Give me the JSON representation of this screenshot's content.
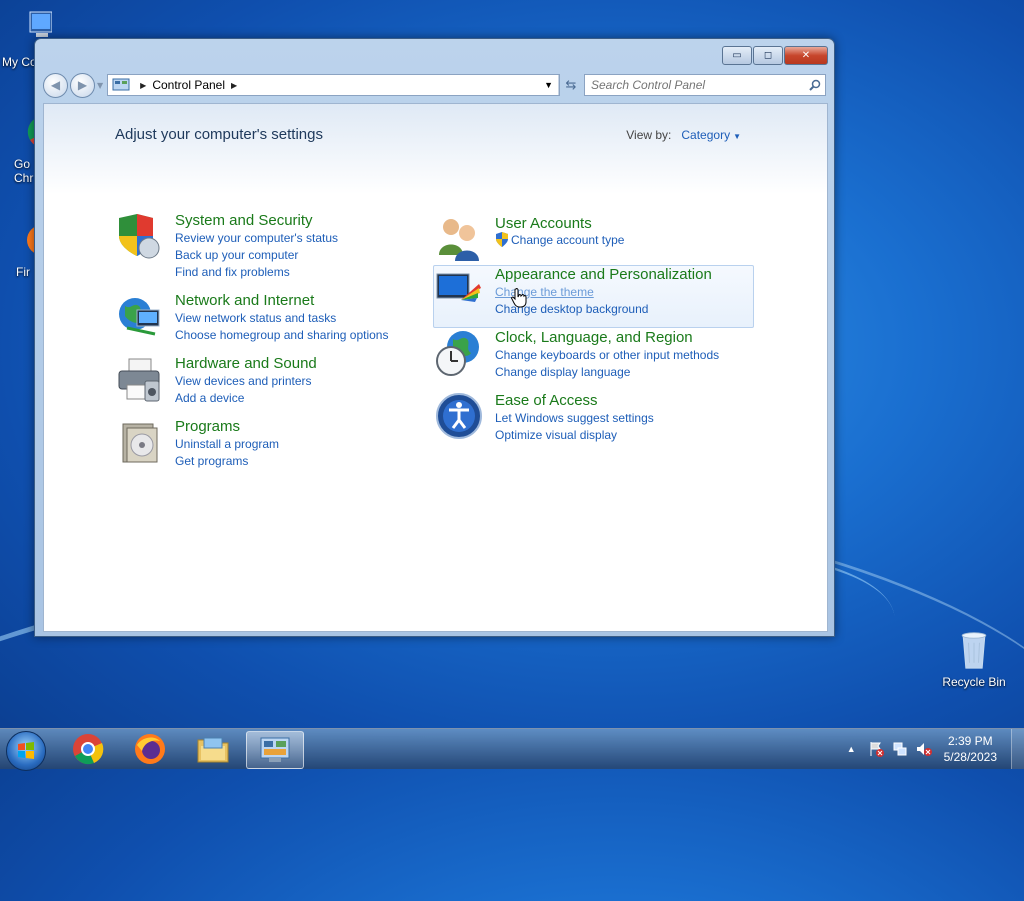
{
  "desktop": {
    "icons": [
      {
        "label": "My Co",
        "icon": "computer-icon"
      },
      {
        "label": "Go\nChr",
        "icon": "chrome-icon"
      },
      {
        "label": "Fir",
        "icon": "firefox-icon"
      },
      {
        "label": "Recycle Bin",
        "icon": "recycle-bin-icon"
      }
    ]
  },
  "window": {
    "caption_buttons": {
      "minimize": "▭",
      "maximize": "◻",
      "close": "✕"
    },
    "address": {
      "root_icon": "control-panel-icon",
      "crumb": "Control Panel"
    },
    "search": {
      "placeholder": "Search Control Panel"
    },
    "heading": "Adjust your computer's settings",
    "view_by": {
      "label": "View by:",
      "value": "Category"
    },
    "categories_left": [
      {
        "title": "System and Security",
        "icon": "shield-icon",
        "links": [
          "Review your computer's status",
          "Back up your computer",
          "Find and fix problems"
        ]
      },
      {
        "title": "Network and Internet",
        "icon": "globe-network-icon",
        "links": [
          "View network status and tasks",
          "Choose homegroup and sharing options"
        ]
      },
      {
        "title": "Hardware and Sound",
        "icon": "printer-icon",
        "links": [
          "View devices and printers",
          "Add a device"
        ]
      },
      {
        "title": "Programs",
        "icon": "programs-icon",
        "links": [
          "Uninstall a program",
          "Get programs"
        ]
      }
    ],
    "categories_right": [
      {
        "title": "User Accounts",
        "icon": "users-icon",
        "links": [
          "Change account type"
        ]
      },
      {
        "title": "Appearance and Personalization",
        "icon": "appearance-icon",
        "links": [
          "Change the theme",
          "Change desktop background"
        ]
      },
      {
        "title": "Clock, Language, and Region",
        "icon": "clock-globe-icon",
        "links": [
          "Change keyboards or other input methods",
          "Change display language"
        ]
      },
      {
        "title": "Ease of Access",
        "icon": "ease-of-access-icon",
        "links": [
          "Let Windows suggest settings",
          "Optimize visual display"
        ]
      }
    ]
  },
  "taskbar": {
    "apps": [
      "chrome-icon",
      "firefox-icon",
      "file-explorer-icon",
      "control-panel-icon"
    ],
    "clock": {
      "time": "2:39 PM",
      "date": "5/28/2023"
    }
  }
}
